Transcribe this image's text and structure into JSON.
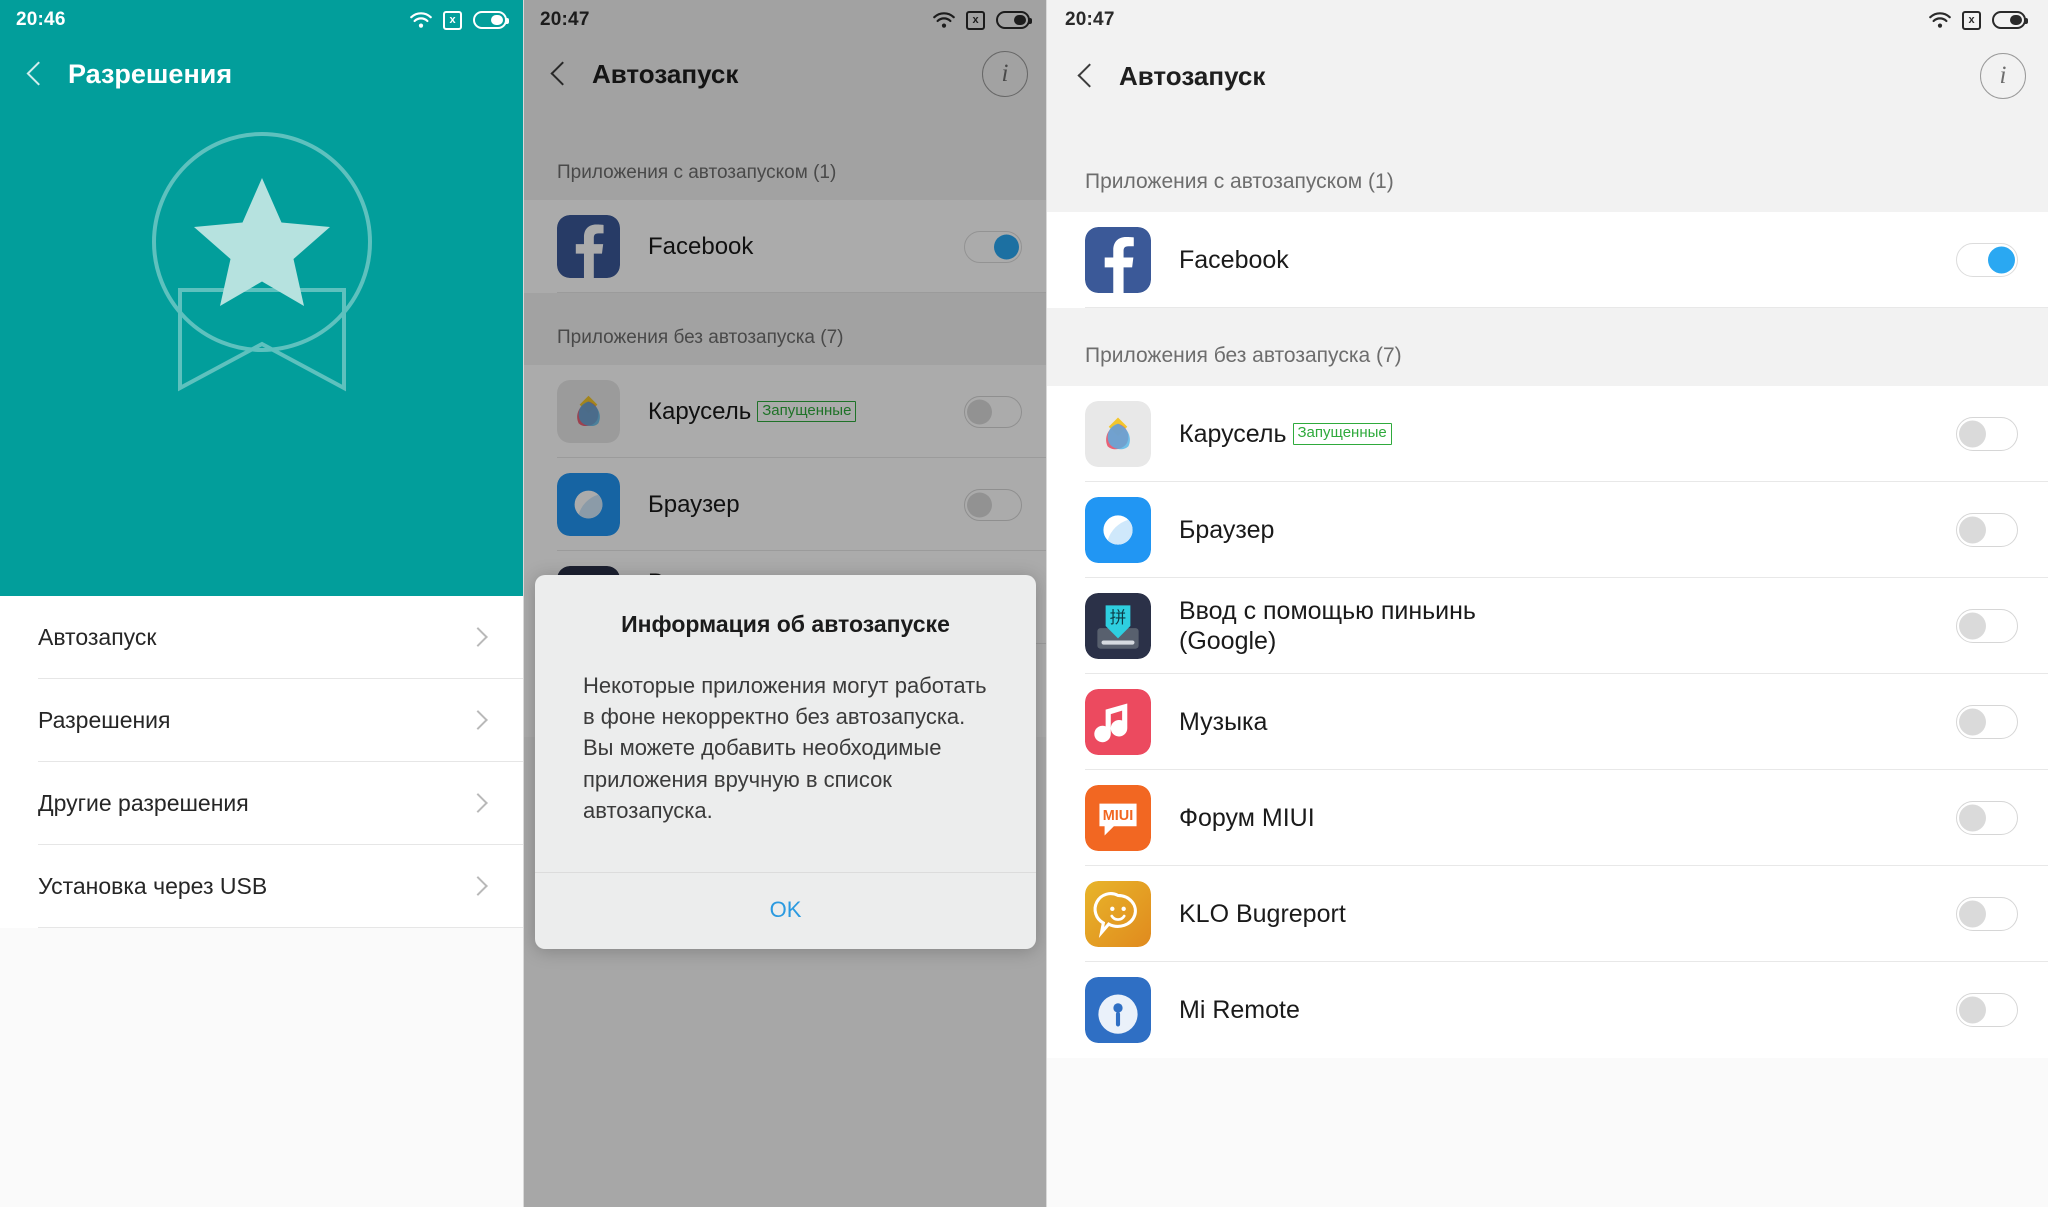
{
  "panel1": {
    "status": {
      "time": "20:46",
      "wifi": "wifi-icon",
      "sim": "sim-disabled-icon",
      "sim_glyph": "x",
      "battery": "battery-icon"
    },
    "appbar": {
      "back": "back-chevron-icon",
      "title": "Разрешения"
    },
    "hero": {
      "illustration": "badge-star-ribbon-illustration"
    },
    "items": [
      {
        "label": "Автозапуск",
        "chevron": "chevron-right-icon"
      },
      {
        "label": "Разрешения",
        "chevron": "chevron-right-icon"
      },
      {
        "label": "Другие разрешения",
        "chevron": "chevron-right-icon"
      },
      {
        "label": "Установка через USB",
        "chevron": "chevron-right-icon"
      }
    ],
    "colors": {
      "accent": "#029e9b",
      "hero_line": "#5fc0bd",
      "star": "#b8e3e0"
    }
  },
  "panel2": {
    "status": {
      "time": "20:47",
      "wifi": "wifi-icon",
      "sim": "sim-disabled-icon",
      "sim_glyph": "x",
      "battery": "battery-icon"
    },
    "appbar": {
      "back": "back-chevron-icon",
      "title": "Автозапуск",
      "info": "info-circle-icon",
      "info_glyph": "i"
    },
    "sections": [
      {
        "heading": "Приложения с автозапуском (1)",
        "apps": [
          {
            "name": "Facebook",
            "badge": "",
            "toggle": "on",
            "icon": "facebook-icon"
          }
        ]
      },
      {
        "heading": "Приложения без автозапуска (7)",
        "apps": [
          {
            "name": "Карусель",
            "badge": "Запущенные",
            "toggle": "off",
            "icon": "carousel-icon"
          },
          {
            "name": "Браузер",
            "badge": "",
            "toggle": "off",
            "icon": "browser-icon"
          },
          {
            "name": "Ввод с помощью пиньинь\n(Google)",
            "badge": "",
            "toggle": "off",
            "icon": "pinyin-keyboard-icon"
          },
          {
            "name": "Mi Remote",
            "badge": "",
            "toggle": "off",
            "icon": "mi-remote-icon"
          }
        ]
      }
    ],
    "dialog": {
      "title": "Информация об автозапуске",
      "body": "Некоторые приложения могут работать в фоне некорректно без автозапуска. Вы можете добавить необходимые приложения вручную в список автозапуска.",
      "ok": "OK",
      "ok_color": "#2b9ae0"
    }
  },
  "panel3": {
    "status": {
      "time": "20:47",
      "wifi": "wifi-icon",
      "sim": "sim-disabled-icon",
      "sim_glyph": "x",
      "battery": "battery-icon"
    },
    "appbar": {
      "back": "back-chevron-icon",
      "title": "Автозапуск",
      "info": "info-circle-icon",
      "info_glyph": "i"
    },
    "sections": [
      {
        "heading": "Приложения с автозапуском (1)",
        "apps": [
          {
            "name": "Facebook",
            "badge": "",
            "toggle": "on",
            "icon": "facebook-icon"
          }
        ]
      },
      {
        "heading": "Приложения без автозапуска (7)",
        "apps": [
          {
            "name": "Карусель",
            "badge": "Запущенные",
            "toggle": "off",
            "icon": "carousel-icon"
          },
          {
            "name": "Браузер",
            "badge": "",
            "toggle": "off",
            "icon": "browser-icon"
          },
          {
            "name": "Ввод с помощью пиньинь\n(Google)",
            "badge": "",
            "toggle": "off",
            "icon": "pinyin-keyboard-icon"
          },
          {
            "name": "Музыка",
            "badge": "",
            "toggle": "off",
            "icon": "music-icon"
          },
          {
            "name": "Форум MIUI",
            "badge": "",
            "toggle": "off",
            "icon": "miui-forum-icon"
          },
          {
            "name": "KLO Bugreport",
            "badge": "",
            "toggle": "off",
            "icon": "klo-bugreport-icon"
          },
          {
            "name": "Mi Remote",
            "badge": "",
            "toggle": "off",
            "icon": "mi-remote-icon"
          }
        ]
      }
    ]
  }
}
